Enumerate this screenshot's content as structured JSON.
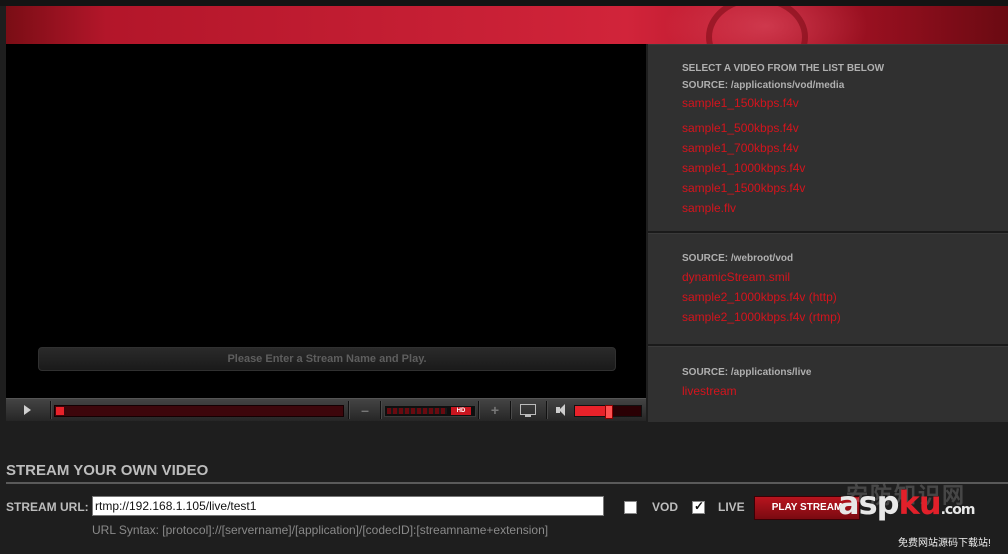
{
  "player": {
    "message": "Please Enter a Stream Name and Play.",
    "hd_badge": "HD",
    "minus_label": "–",
    "plus_label": "+",
    "volume_level": 0.52
  },
  "playlist": {
    "heading": "SELECT A VIDEO FROM THE LIST BELOW",
    "sources": [
      {
        "source": "SOURCE: /applications/vod/media",
        "items": [
          "sample1_150kbps.f4v",
          "sample1_500kbps.f4v",
          "sample1_700kbps.f4v",
          "sample1_1000kbps.f4v",
          "sample1_1500kbps.f4v",
          "sample.flv"
        ]
      },
      {
        "source": "SOURCE: /webroot/vod",
        "items": [
          "dynamicStream.smil",
          "sample2_1000kbps.f4v (http)",
          "sample2_1000kbps.f4v (rtmp)"
        ]
      },
      {
        "source": "SOURCE: /applications/live",
        "items": [
          "livestream"
        ]
      }
    ]
  },
  "own": {
    "title": "STREAM YOUR OWN VIDEO",
    "url_label": "STREAM URL:",
    "url_value": "rtmp://192.168.1.105/live/test1",
    "syntax": "URL Syntax: [protocol]://[servername]/[application]/[codecID]:[streamname+extension]",
    "vod_label": "VOD",
    "vod_checked": false,
    "live_label": "LIVE",
    "live_checked": true,
    "play_button": "PLAY STREAM"
  },
  "watermark": {
    "ghost": "安防知识网",
    "brand_a": "asp",
    "brand_b": "ku",
    "brand_c": ".com",
    "tagline": "免费网站源码下载站!"
  },
  "colors": {
    "link_red": "#d4141d",
    "accent_red": "#e8222a",
    "banner_red": "#c41e33"
  }
}
